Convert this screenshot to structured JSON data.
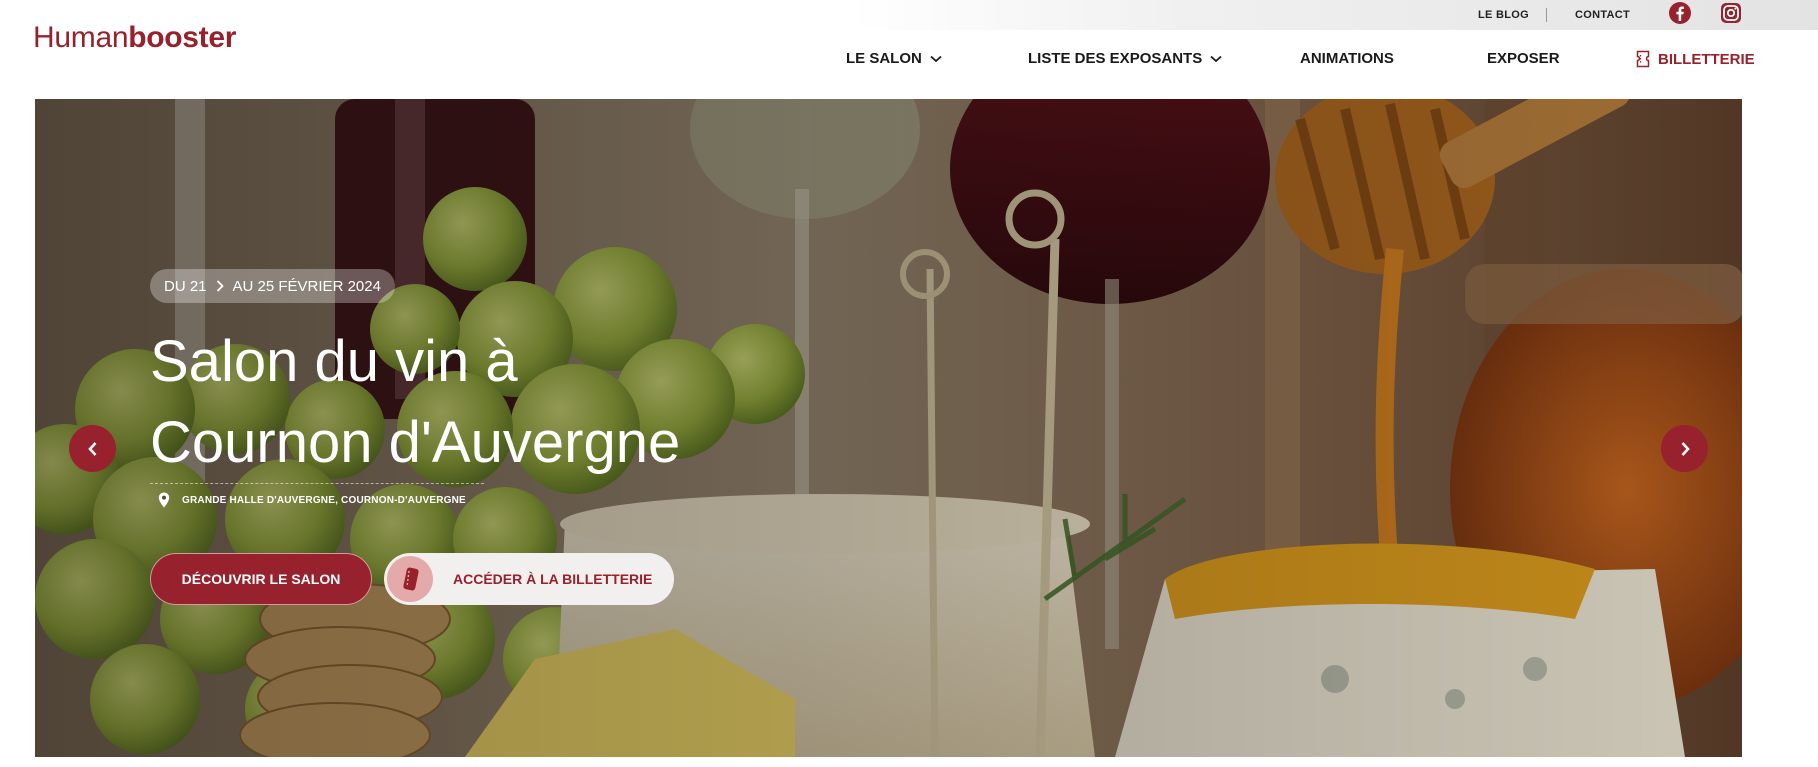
{
  "brand": {
    "logo_light": "Human",
    "logo_bold": "booster",
    "accent": "#97212c"
  },
  "topbar": {
    "links": [
      {
        "label": "LE BLOG"
      },
      {
        "label": "CONTACT"
      }
    ],
    "social": [
      {
        "icon": "facebook-icon"
      },
      {
        "icon": "instagram-icon"
      }
    ]
  },
  "nav": {
    "items": [
      {
        "label": "LE SALON",
        "has_dropdown": true
      },
      {
        "label": "LISTE DES EXPOSANTS",
        "has_dropdown": true
      },
      {
        "label": "ANIMATIONS",
        "has_dropdown": false
      },
      {
        "label": "EXPOSER",
        "has_dropdown": false
      }
    ],
    "ticket": {
      "label": "BILLETTERIE",
      "icon": "ticket-icon"
    }
  },
  "hero": {
    "date_start": "DU 21",
    "date_end": "AU 25 FÉVRIER 2024",
    "title_line1": "Salon du vin à",
    "title_line2": "Cournon d'Auvergne",
    "location": "GRANDE HALLE D'AUVERGNE, COURNON-D'AUVERGNE",
    "cta_primary": "DÉCOUVRIR LE SALON",
    "cta_secondary": "ACCÉDER À LA BILLETTERIE",
    "prev_icon": "chevron-left-icon",
    "next_icon": "chevron-right-icon"
  }
}
